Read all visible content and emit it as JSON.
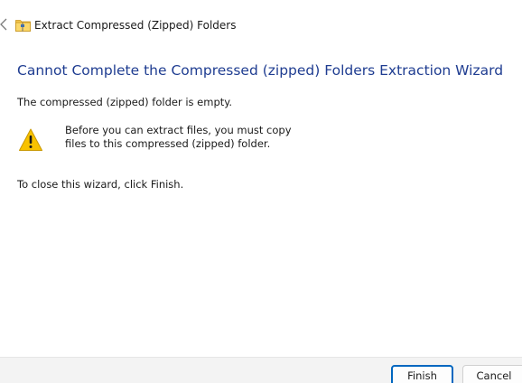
{
  "window": {
    "title": "Extract Compressed (Zipped) Folders",
    "icons": {
      "back": "back-arrow-icon",
      "app": "zipped-folder-icon"
    }
  },
  "wizard": {
    "heading": "Cannot Complete the Compressed (zipped) Folders Extraction Wizard",
    "empty_message": "The compressed (zipped) folder is empty.",
    "warning": {
      "icon": "warning-icon",
      "line1": "Before you can extract files, you must copy",
      "line2": "files to this compressed (zipped) folder."
    },
    "close_instructions": "To close this wizard, click Finish."
  },
  "buttons": {
    "finish": "Finish",
    "cancel": "Cancel"
  },
  "colors": {
    "heading": "#1f3d91",
    "accent": "#0067c0",
    "warning_fill": "#f8c200",
    "button_bar": "#f3f3f3"
  }
}
